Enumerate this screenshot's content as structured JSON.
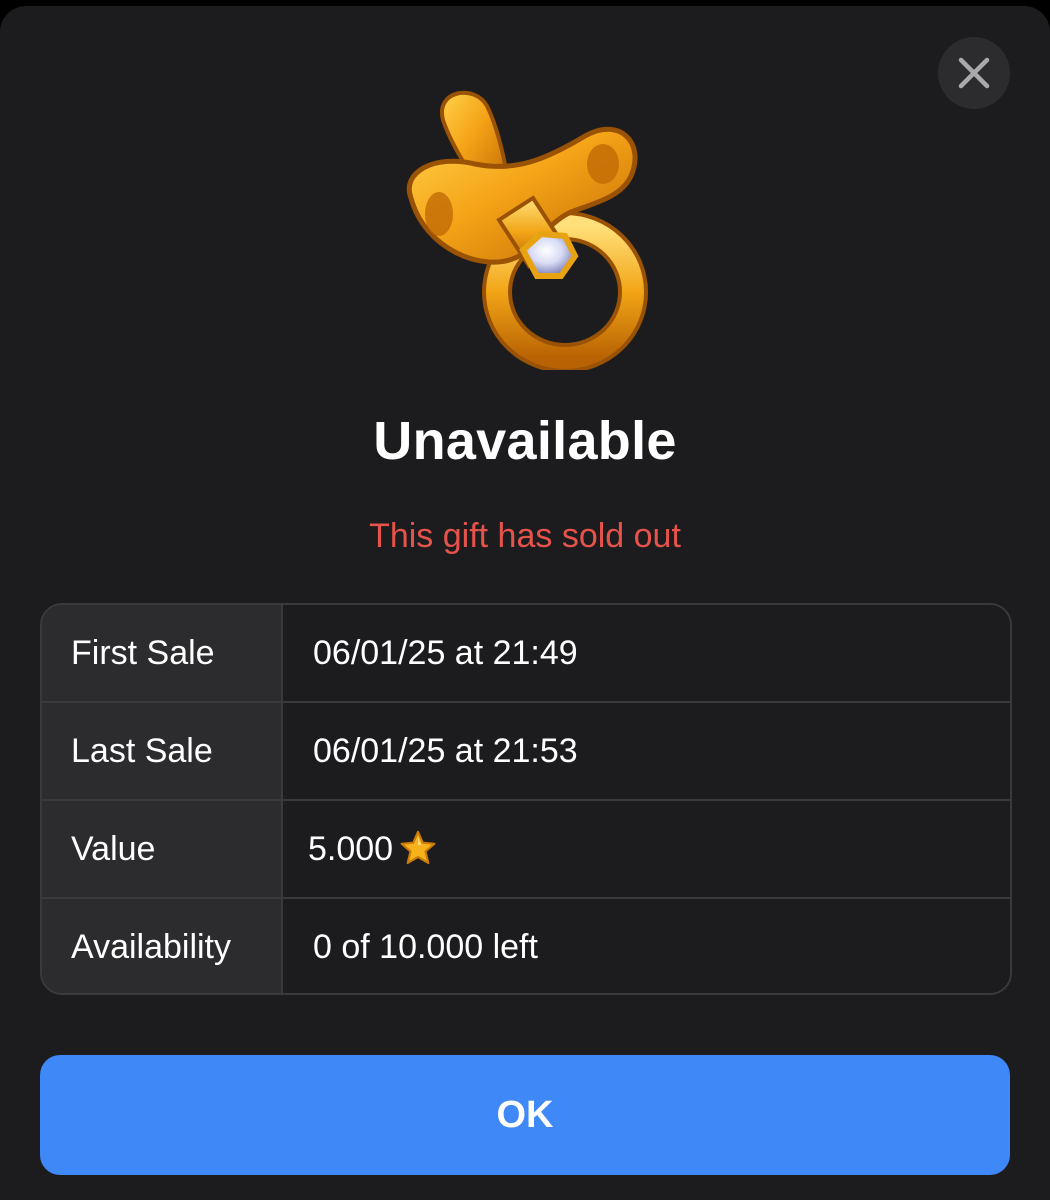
{
  "dialog": {
    "close_icon": "close-icon",
    "gift_icon": "pacifier-icon",
    "title": "Unavailable",
    "subtitle": "This gift has sold out",
    "rows": [
      {
        "label": "First Sale",
        "value": "06/01/25 at 21:49"
      },
      {
        "label": "Last Sale",
        "value": "06/01/25 at 21:53"
      },
      {
        "label": "Value",
        "value": "5.000",
        "icon": "star-icon"
      },
      {
        "label": "Availability",
        "value": "0 of 10.000 left"
      }
    ],
    "ok_label": "OK"
  },
  "colors": {
    "background": "#1c1c1e",
    "label_cell": "#2c2c2e",
    "border": "#3a3a3c",
    "subtitle": "#e5534b",
    "button": "#3e88f7",
    "gold": "#f2a516"
  }
}
